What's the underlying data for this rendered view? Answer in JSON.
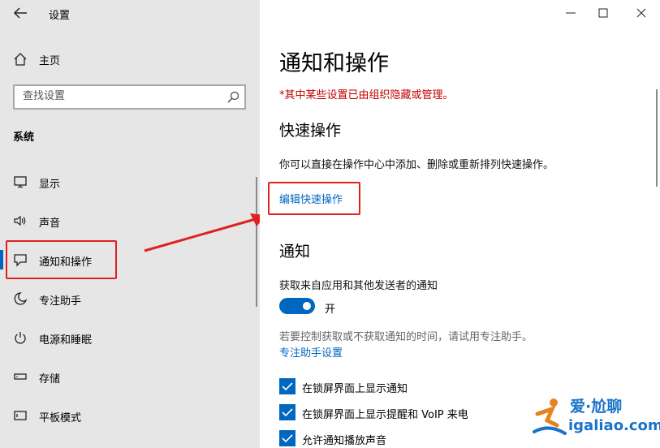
{
  "window": {
    "app_title": "设置"
  },
  "sidebar": {
    "home_label": "主页",
    "search_placeholder": "查找设置",
    "section_label": "系统",
    "items": [
      {
        "label": "显示",
        "icon": "monitor-icon",
        "active": false
      },
      {
        "label": "声音",
        "icon": "speaker-icon",
        "active": false
      },
      {
        "label": "通知和操作",
        "icon": "notification-icon",
        "active": true
      },
      {
        "label": "专注助手",
        "icon": "moon-icon",
        "active": false
      },
      {
        "label": "电源和睡眠",
        "icon": "power-icon",
        "active": false
      },
      {
        "label": "存储",
        "icon": "storage-icon",
        "active": false
      },
      {
        "label": "平板模式",
        "icon": "tablet-icon",
        "active": false
      }
    ]
  },
  "main": {
    "title": "通知和操作",
    "policy_note": "*其中某些设置已由组织隐藏或管理。",
    "quick_actions": {
      "heading": "快速操作",
      "description": "你可以直接在操作中心中添加、删除或重新排列快速操作。",
      "edit_link": "编辑快速操作"
    },
    "notifications": {
      "heading": "通知",
      "get_notifications_label": "获取来自应用和其他发送者的通知",
      "toggle_state": "开",
      "toggle_on": true,
      "focus_hint": "若要控制获取或不获取通知的时间，请试用专注助手。",
      "focus_link": "专注助手设置",
      "checkboxes": [
        {
          "label": "在锁屏界面上显示通知",
          "checked": true
        },
        {
          "label": "在锁屏界面上显示提醒和 VoIP 来电",
          "checked": true
        },
        {
          "label": "允许通知播放声音",
          "checked": true
        }
      ]
    }
  },
  "watermark": {
    "line1": "爱·尬聊",
    "line2": "igaliao.com"
  },
  "colors": {
    "accent": "#0067c0",
    "highlight": "#e02020",
    "policy": "#c00000"
  }
}
